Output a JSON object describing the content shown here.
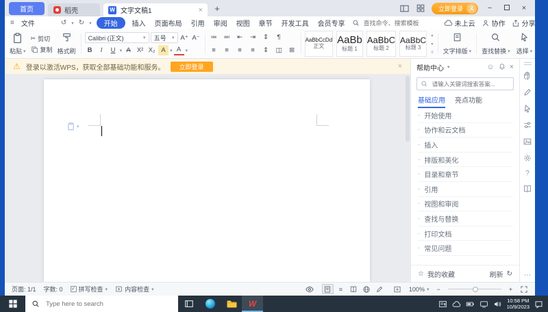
{
  "icon_glyphs": {
    "caret": "▾",
    "up": "▴",
    "down": "▾",
    "close": "×",
    "plus": "+",
    "minus": "−",
    "ellipsis_v": "⋮",
    "ellipsis_h": "⋯",
    "collapse": "∧",
    "undo": "↺",
    "redo": "↻",
    "scissors": "✂",
    "hamburger": "≡",
    "star": "☆",
    "refresh": "↻",
    "smiley": "☺",
    "warning": "⚠",
    "bullet": "·",
    "question": "?",
    "check": "✓",
    "bullets": "≔",
    "numbering": "≕",
    "outdent": "⇤",
    "indent": "⇥",
    "sort": "⇕",
    "pilcrow": "¶",
    "align": "≡",
    "table": "⊞",
    "columns": "◫",
    "superA": "A⁺",
    "subA": "A⁻"
  },
  "titlebar": {
    "home_tab": "首页",
    "docer_tab": "稻壳",
    "doc_tab": "文字文稿1",
    "login": "立即登录"
  },
  "menubar": {
    "file": "文件",
    "menus": [
      "开始",
      "插入",
      "页面布局",
      "引用",
      "审阅",
      "视图",
      "章节",
      "开发工具",
      "会员专享"
    ],
    "search_placeholder": "查找命令、搜索模板",
    "cloud": "未上云",
    "collab": "协作",
    "share": "分享"
  },
  "ribbon": {
    "paste": "粘贴",
    "cut": "剪切",
    "copy": "复制",
    "format_painter": "格式刷",
    "font_name": "Calibri (正文)",
    "font_size": "五号",
    "font_buttons": [
      "B",
      "I",
      "U",
      "A",
      "X²",
      "X₂",
      "A",
      "A"
    ],
    "styles": [
      {
        "sample": "AaBbCcDd",
        "label": "正文"
      },
      {
        "sample": "AaBb",
        "label": "标题 1"
      },
      {
        "sample": "AaBbC",
        "label": "标题 2"
      },
      {
        "sample": "AaBbC",
        "label": "标题 3"
      }
    ],
    "text_layout": "文字排版",
    "find_replace": "查找替换",
    "select": "选择"
  },
  "notification": {
    "warning_text": "登录以激活WPS，获取全部基础功能和服务。",
    "login_button": "立即登录"
  },
  "help_panel": {
    "title": "帮助中心",
    "search_placeholder": "请输入关键词搜索答案...",
    "tab_basic": "基础应用",
    "tab_highlight": "亮点功能",
    "items": [
      "开始使用",
      "协作和云文档",
      "插入",
      "排版和美化",
      "目录和章节",
      "引用",
      "视图和审阅",
      "查找与替换",
      "打印文档",
      "常见问题"
    ],
    "favorites": "我的收藏",
    "refresh_label": "刷新"
  },
  "statusbar": {
    "page": "页面: 1/1",
    "words": "字数: 0",
    "spell_check": "拼写检查",
    "content_check": "内容检查",
    "zoom_level": "100%"
  },
  "taskbar": {
    "search_placeholder": "Type here to search",
    "time": "10:58 PM",
    "date": "10/9/2023"
  }
}
